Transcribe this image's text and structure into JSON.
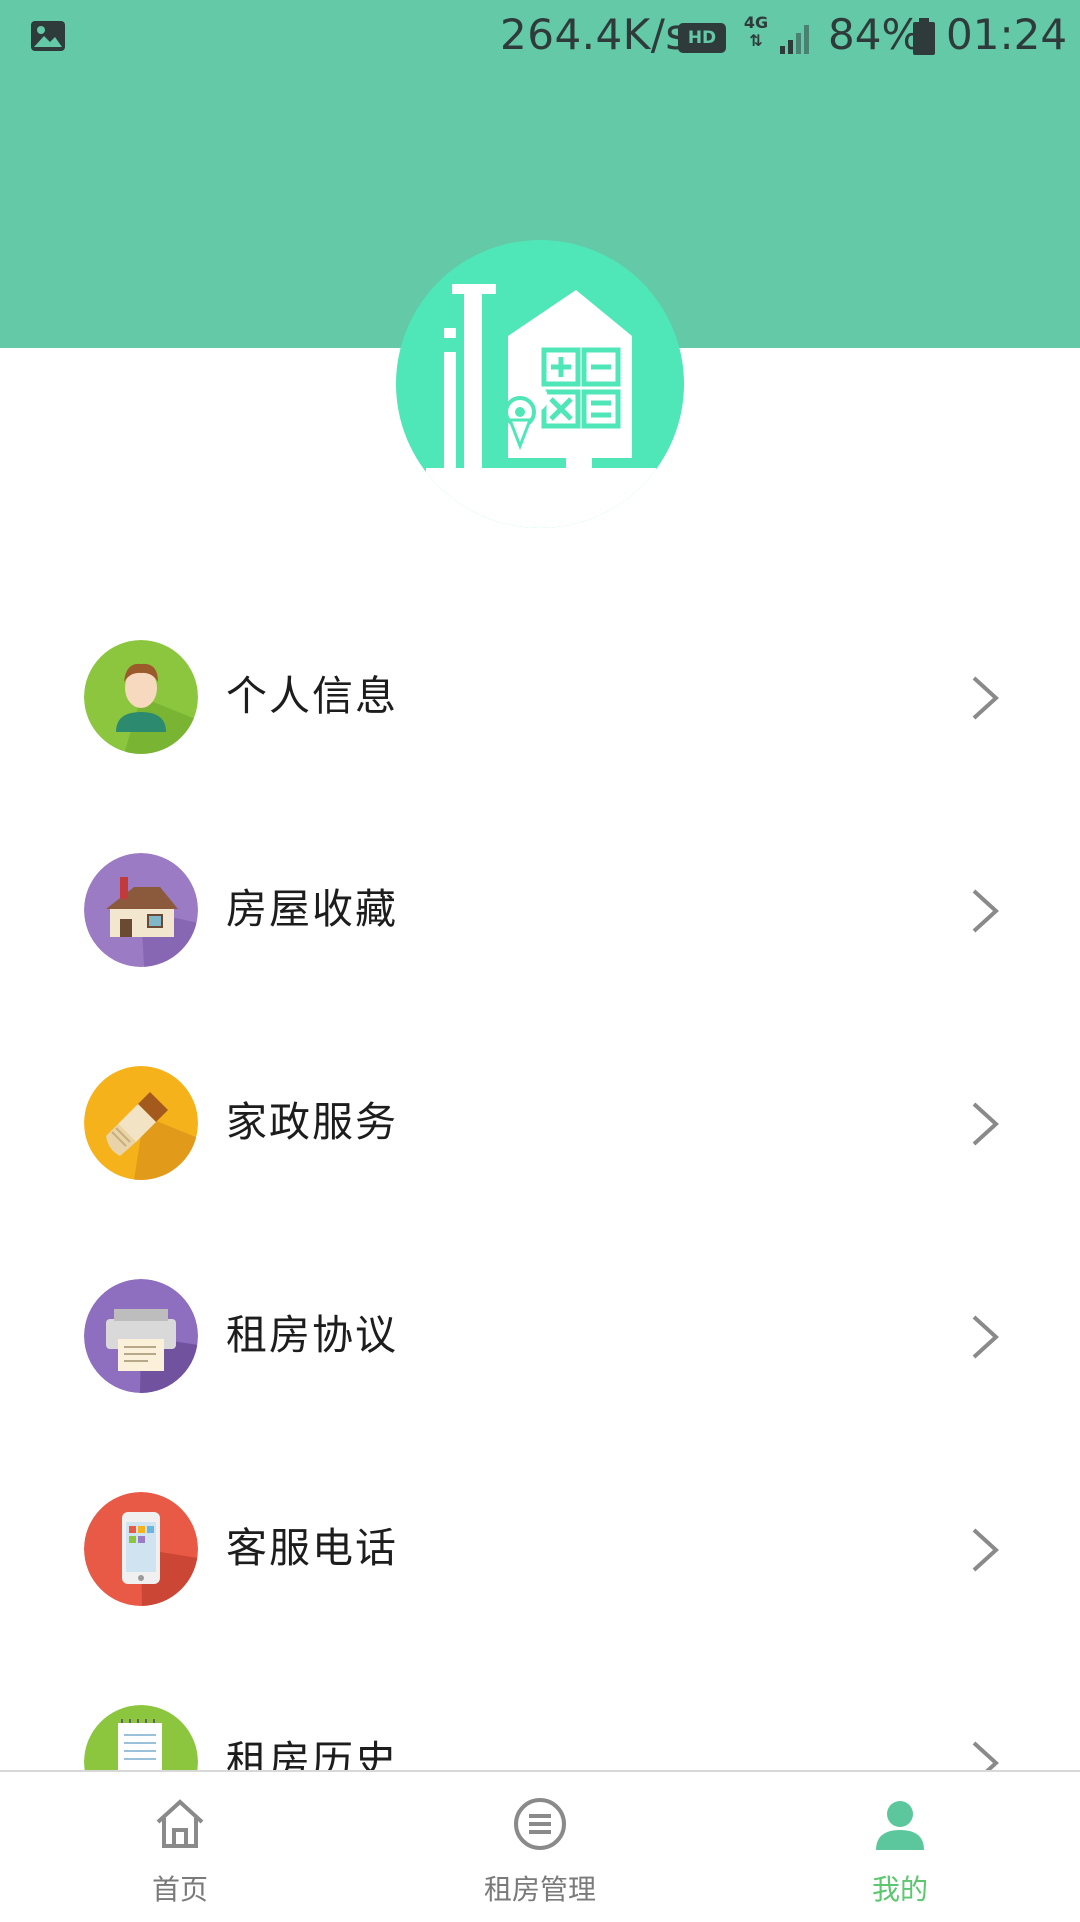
{
  "status_bar": {
    "speed": "264.4K/s",
    "hd_badge": "HD",
    "network": "4G",
    "battery": "84%",
    "time": "01:24"
  },
  "colors": {
    "header": "#63c9a7",
    "logo_circle": "#4fe6b8",
    "active_tab": "#5cc76f",
    "inactive_tab": "#7a7a7a"
  },
  "menu": {
    "items": [
      {
        "label": "个人信息",
        "icon": "user-avatar-icon",
        "color": "#8cc63f"
      },
      {
        "label": "房屋收藏",
        "icon": "house-icon",
        "color": "#9b7bc4"
      },
      {
        "label": "家政服务",
        "icon": "paint-brush-icon",
        "color": "#f5b21a"
      },
      {
        "label": "租房协议",
        "icon": "printer-icon",
        "color": "#8e6fbf"
      },
      {
        "label": "客服电话",
        "icon": "mobile-phone-icon",
        "color": "#e85a45"
      },
      {
        "label": "租房历史",
        "icon": "notepad-icon",
        "color": "#8cc63f"
      }
    ]
  },
  "tabbar": {
    "tabs": [
      {
        "label": "首页",
        "icon": "home-icon",
        "active": false
      },
      {
        "label": "租房管理",
        "icon": "list-icon",
        "active": false
      },
      {
        "label": "我的",
        "icon": "profile-icon",
        "active": true
      }
    ]
  }
}
